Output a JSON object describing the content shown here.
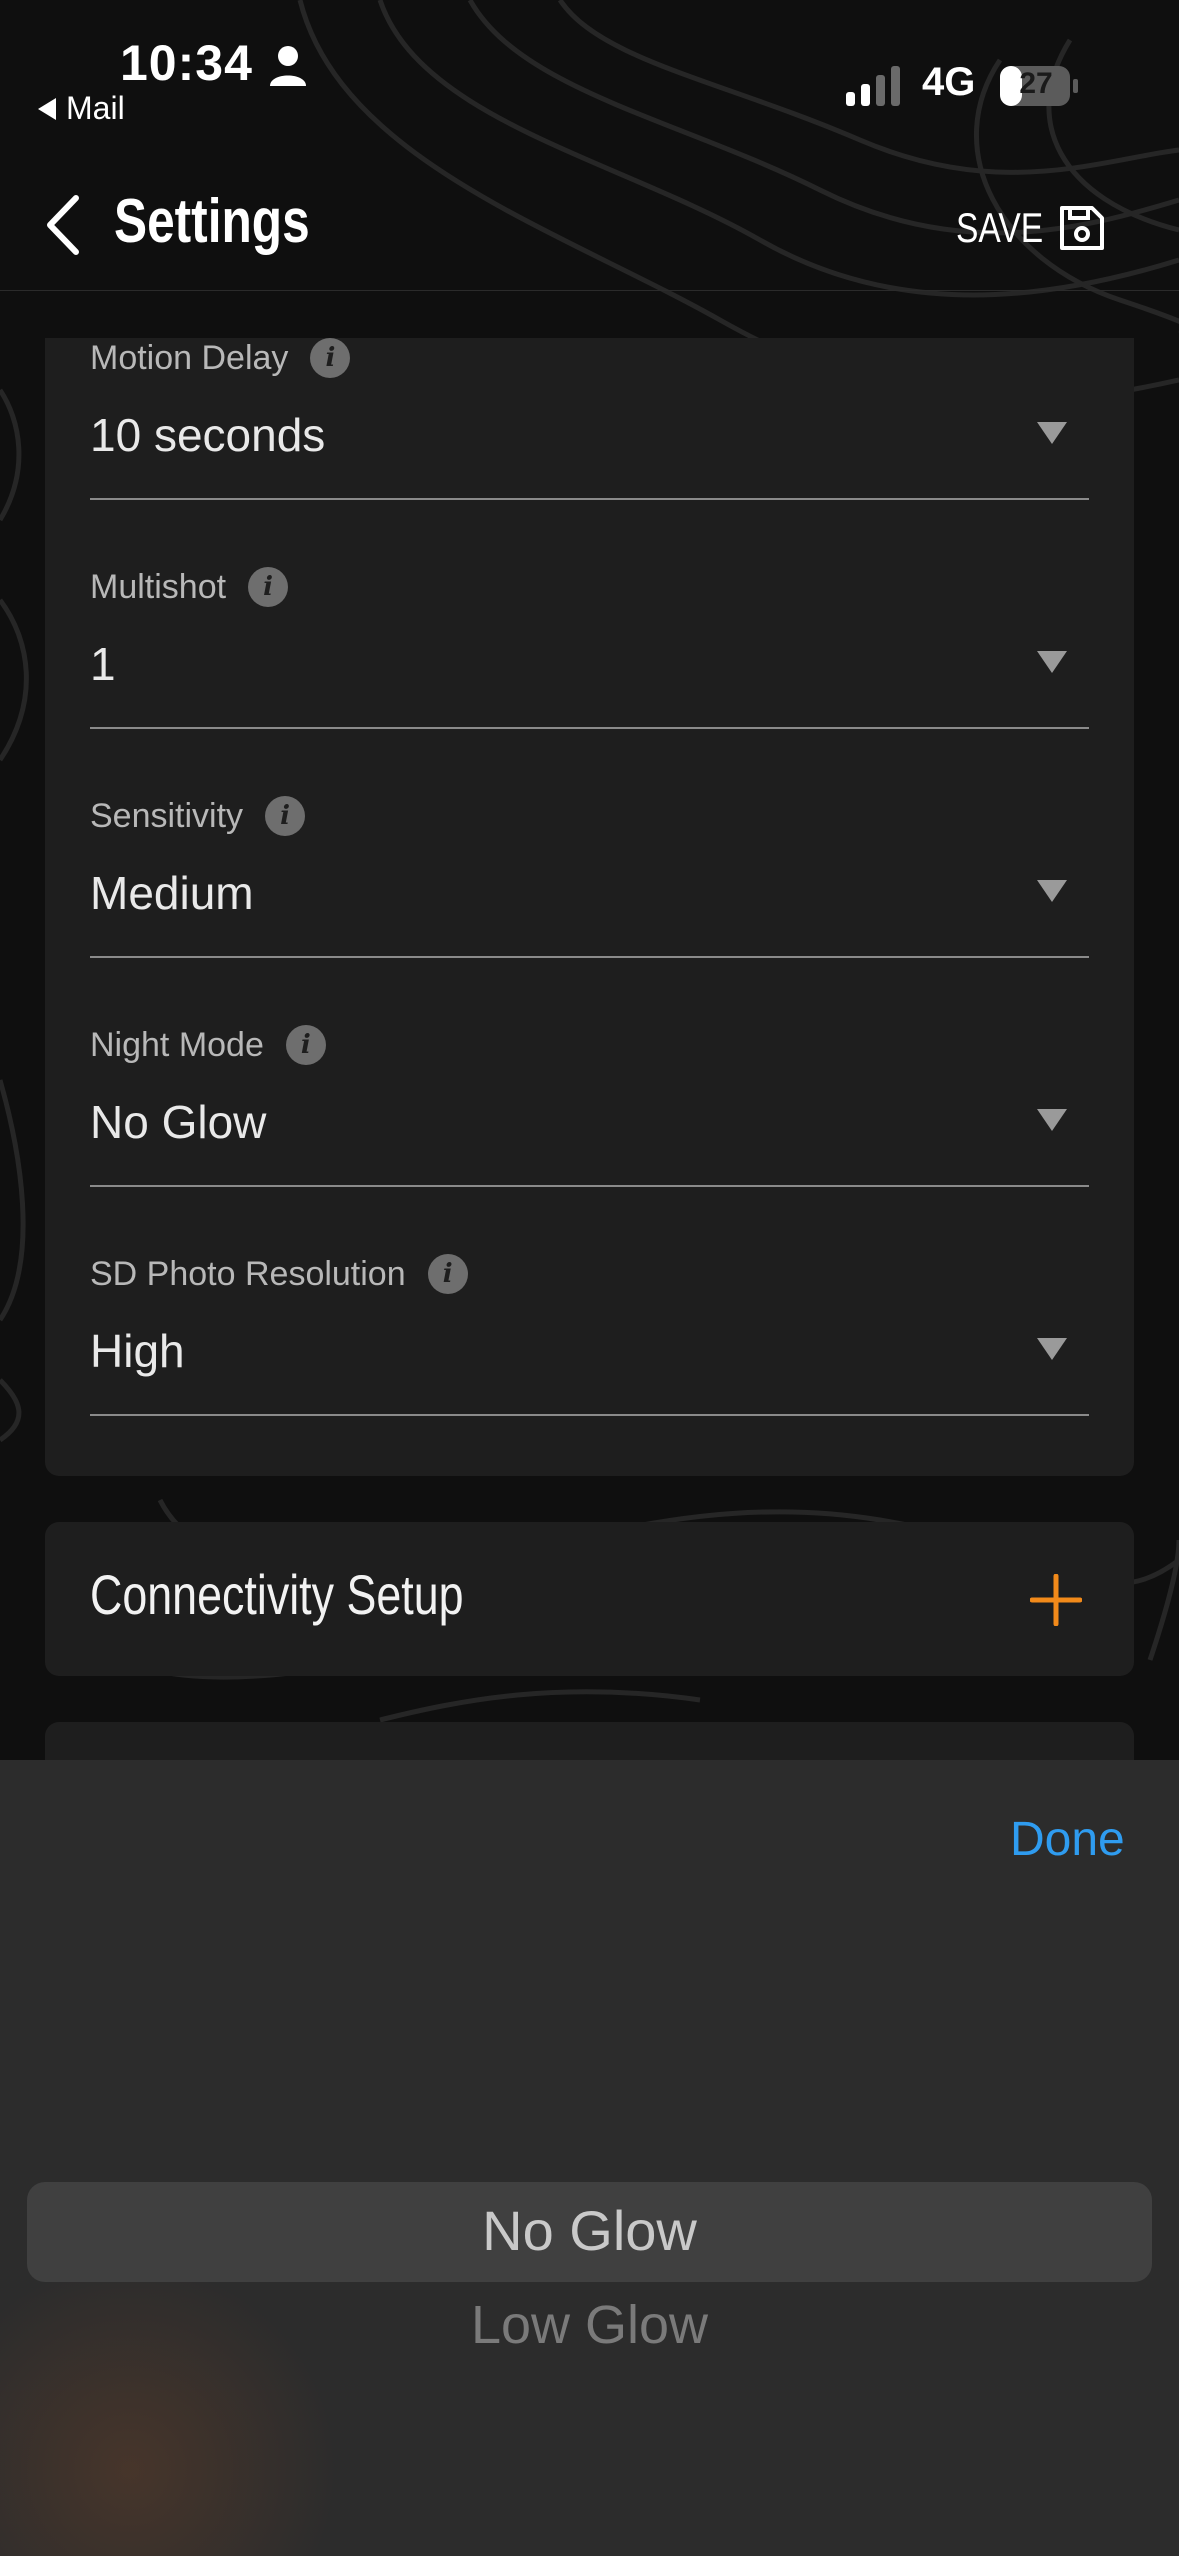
{
  "status_bar": {
    "time": "10:34",
    "back_app": "Mail",
    "network": "4G",
    "battery": "27",
    "icons": [
      "person-icon",
      "signal-icon",
      "battery-icon"
    ]
  },
  "nav": {
    "title": "Settings",
    "save_label": "SAVE",
    "icons": [
      "back-chevron-icon",
      "floppy-disk-icon"
    ]
  },
  "fields": [
    {
      "label": "Motion Delay",
      "value": "10 seconds"
    },
    {
      "label": "Multishot",
      "value": "1"
    },
    {
      "label": "Sensitivity",
      "value": "Medium"
    },
    {
      "label": "Night Mode",
      "value": "No Glow"
    },
    {
      "label": "SD Photo Resolution",
      "value": "High"
    }
  ],
  "info_glyph": "i",
  "connectivity": {
    "title": "Connectivity Setup",
    "icon": "plus-icon"
  },
  "picker": {
    "done_label": "Done",
    "selected": "No Glow",
    "next_option": "Low Glow"
  },
  "colors": {
    "background": "#0f0f0f",
    "card": "#1e1e1e",
    "accent_orange": "#f28a1a",
    "done_blue": "#2f9cf0",
    "sheet": "#2c2c2c"
  }
}
